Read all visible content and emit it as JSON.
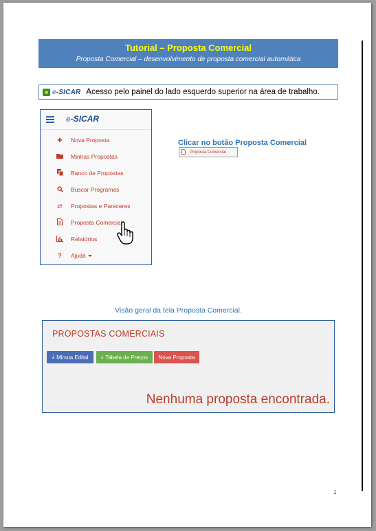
{
  "title": {
    "main": "Tutorial – Proposta Comercial",
    "subtitle": "Proposta Comercial – desenvolvimento de proposta comercial automática"
  },
  "access": {
    "logo_text": "e-SICAR",
    "text": "Acesso pelo painel do lado esquerdo superior na área de trabalho."
  },
  "menu": {
    "logo": "e-SICAR",
    "items": [
      {
        "label": "Nova Proposta",
        "icon": "plus-icon"
      },
      {
        "label": "Minhas Propostas",
        "icon": "folder-icon"
      },
      {
        "label": "Banco de Propostas",
        "icon": "copy-icon"
      },
      {
        "label": "Buscar Programas",
        "icon": "search-icon"
      },
      {
        "label": "Propostas e Pareceres",
        "icon": "retweet-icon"
      },
      {
        "label": "Proposta Comercial",
        "icon": "file-icon"
      },
      {
        "label": "Relatórios",
        "icon": "bar-chart-icon"
      },
      {
        "label": "Ajuda",
        "icon": "question-icon"
      }
    ]
  },
  "instruction": {
    "text": "Clicar no botão Proposta Comercial",
    "button_label": "Proposta Comercial"
  },
  "overview": {
    "caption": "Visão geral da tela Proposta Comercial."
  },
  "screen": {
    "title": "PROPOSTAS COMERCIAIS",
    "buttons": {
      "minuta": "Minuta Edital",
      "tabela": "Tabela de Preços",
      "nova": "Nova Proposta"
    },
    "empty_message": "Nenhuma proposta encontrada."
  },
  "page_number": "1",
  "colors": {
    "banner": "#4f81bd",
    "title_yellow": "#ffff00",
    "accent_red": "#c0392b",
    "link_blue": "#2e75b6"
  }
}
